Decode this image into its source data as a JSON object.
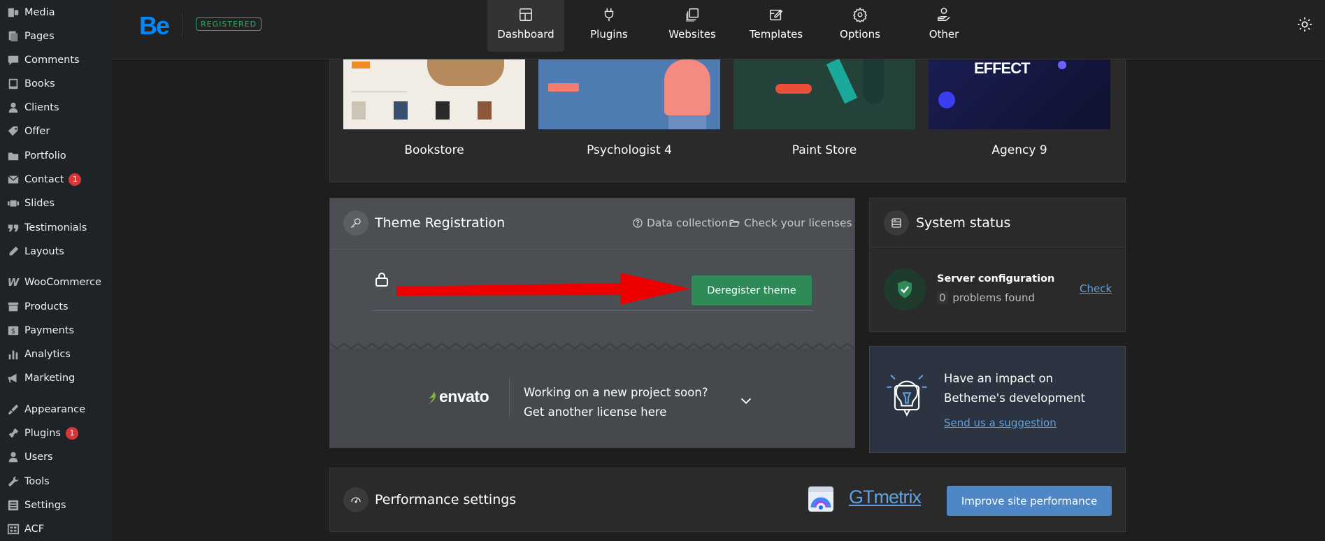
{
  "sidebar": {
    "items": [
      {
        "label": "Media",
        "icon": "media-icon"
      },
      {
        "label": "Pages",
        "icon": "pages-icon"
      },
      {
        "label": "Comments",
        "icon": "comments-icon"
      },
      {
        "label": "Books",
        "icon": "books-icon"
      },
      {
        "label": "Clients",
        "icon": "clients-icon"
      },
      {
        "label": "Offer",
        "icon": "offer-icon"
      },
      {
        "label": "Portfolio",
        "icon": "portfolio-icon"
      },
      {
        "label": "Contact",
        "icon": "contact-icon",
        "badge": "1"
      },
      {
        "label": "Slides",
        "icon": "slides-icon"
      },
      {
        "label": "Testimonials",
        "icon": "testimonials-icon"
      },
      {
        "label": "Layouts",
        "icon": "layouts-icon"
      },
      {
        "label": "WooCommerce",
        "icon": "woocommerce-icon"
      },
      {
        "label": "Products",
        "icon": "products-icon"
      },
      {
        "label": "Payments",
        "icon": "payments-icon"
      },
      {
        "label": "Analytics",
        "icon": "analytics-icon"
      },
      {
        "label": "Marketing",
        "icon": "marketing-icon"
      },
      {
        "label": "Appearance",
        "icon": "appearance-icon"
      },
      {
        "label": "Plugins",
        "icon": "plugins-icon",
        "badge": "1"
      },
      {
        "label": "Users",
        "icon": "users-icon"
      },
      {
        "label": "Tools",
        "icon": "tools-icon"
      },
      {
        "label": "Settings",
        "icon": "settings-icon"
      },
      {
        "label": "ACF",
        "icon": "acf-icon"
      }
    ]
  },
  "topbar": {
    "logo": "Be",
    "registered": "REGISTERED",
    "tabs": [
      {
        "label": "Dashboard",
        "icon": "dashboard-icon",
        "active": true
      },
      {
        "label": "Plugins",
        "icon": "plug-icon"
      },
      {
        "label": "Websites",
        "icon": "websites-icon"
      },
      {
        "label": "Templates",
        "icon": "templates-icon"
      },
      {
        "label": "Options",
        "icon": "options-gear-icon"
      },
      {
        "label": "Other",
        "icon": "other-icon"
      }
    ]
  },
  "templates": [
    {
      "name": "Bookstore"
    },
    {
      "name": "Psychologist 4"
    },
    {
      "name": "Paint Store"
    },
    {
      "name": "Agency 9"
    }
  ],
  "theme_registration": {
    "title": "Theme Registration",
    "data_collection": "Data collection",
    "check_licenses": "Check your licenses",
    "deregister": "Deregister theme",
    "envato": "envato",
    "promo_line1": "Working on a new project soon?",
    "promo_line2": "Get another license here"
  },
  "system_status": {
    "title": "System status",
    "server_config": "Server configuration",
    "problems_count": "0",
    "problems_text": "problems found",
    "check": "Check"
  },
  "impact": {
    "line1": "Have an impact on",
    "line2": "Betheme's development",
    "link": "Send us a suggestion"
  },
  "performance": {
    "title": "Performance settings",
    "gtmetrix": "GTmetrix",
    "button": "Improve site performance"
  },
  "colors": {
    "accent_blue": "#0089f7",
    "green": "#2e8b57",
    "arrow_red": "#ee0000",
    "button_blue": "#4f86c6"
  }
}
